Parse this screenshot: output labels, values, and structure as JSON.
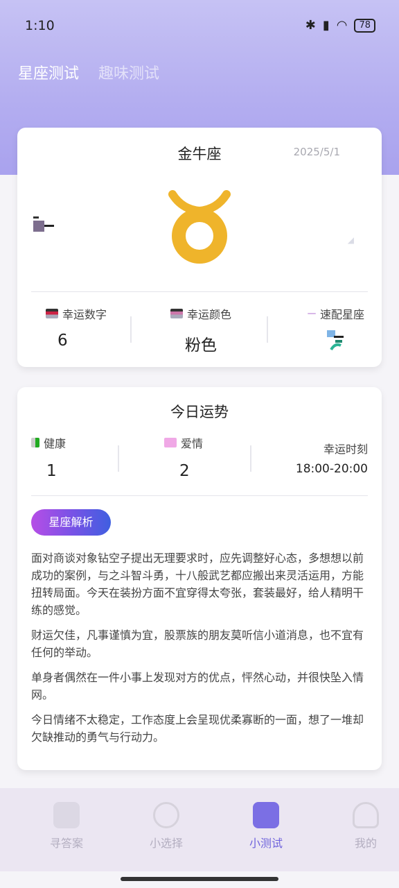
{
  "status_bar": {
    "time": "1:10",
    "battery": "78",
    "icons": [
      "bluetooth-icon",
      "hd-signal-icon",
      "wifi-icon",
      "battery-icon"
    ]
  },
  "top_tabs": [
    {
      "label": "星座测试",
      "active": true
    },
    {
      "label": "趣味测试",
      "active": false
    }
  ],
  "sign_card": {
    "name": "金牛座",
    "date": "2025/5/1",
    "emblem_color": "#efb42b",
    "stats": [
      {
        "label": "幸运数字",
        "value": "6"
      },
      {
        "label": "幸运颜色",
        "value": "粉色"
      },
      {
        "label": "速配星座",
        "value": ""
      }
    ]
  },
  "fortune_card": {
    "title": "今日运势",
    "health_label": "健康",
    "health_value": "1",
    "love_label": "爱情",
    "love_value": "2",
    "lucky_time_label": "幸运时刻",
    "lucky_time_value": "18:00-20:00",
    "analysis_button": "星座解析",
    "paragraphs": [
      "面对商谈对象钻空子提出无理要求时，应先调整好心态，多想想以前成功的案例，与之斗智斗勇，十八般武艺都应搬出来灵活运用，方能扭转局面。今天在装扮方面不宜穿得太夸张，套装最好，给人精明干练的感觉。",
      "财运欠佳，凡事谨慎为宜，股票族的朋友莫听信小道消息，也不宜有任何的举动。",
      "单身者偶然在一件小事上发现对方的优点，怦然心动，并很快坠入情网。",
      "今日情绪不太稳定，工作态度上会呈现优柔寡断的一面，想了一堆却欠缺推动的勇气与行动力。"
    ]
  },
  "bottom_nav": [
    {
      "label": "寻答案",
      "active": false
    },
    {
      "label": "小选择",
      "active": false
    },
    {
      "label": "小测试",
      "active": true
    },
    {
      "label": "我的",
      "active": false
    }
  ],
  "colors": {
    "accent": "#6f63dc",
    "header_bg": "#b3adf0",
    "emblem": "#efb42b"
  }
}
